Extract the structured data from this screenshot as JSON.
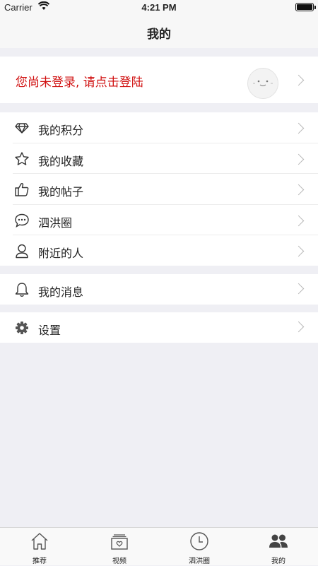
{
  "status": {
    "carrier": "Carrier",
    "time": "4:21 PM"
  },
  "header": {
    "title": "我的"
  },
  "login": {
    "prompt": "您尚未登录, 请点击登陆"
  },
  "menu_group1": [
    {
      "label": "我的积分",
      "icon": "diamond-icon"
    },
    {
      "label": "我的收藏",
      "icon": "star-icon"
    },
    {
      "label": "我的帖子",
      "icon": "thumbs-up-icon"
    },
    {
      "label": "泗洪圈",
      "icon": "chat-bubble-icon"
    },
    {
      "label": "附近的人",
      "icon": "person-icon"
    }
  ],
  "menu_group2": [
    {
      "label": "我的消息",
      "icon": "bell-icon"
    }
  ],
  "menu_group3": [
    {
      "label": "设置",
      "icon": "gear-icon"
    }
  ],
  "tabs": [
    {
      "label": "推荐",
      "icon": "home-icon"
    },
    {
      "label": "视频",
      "icon": "video-icon"
    },
    {
      "label": "泗洪圈",
      "icon": "clock-icon"
    },
    {
      "label": "我的",
      "icon": "users-icon",
      "active": true
    }
  ]
}
